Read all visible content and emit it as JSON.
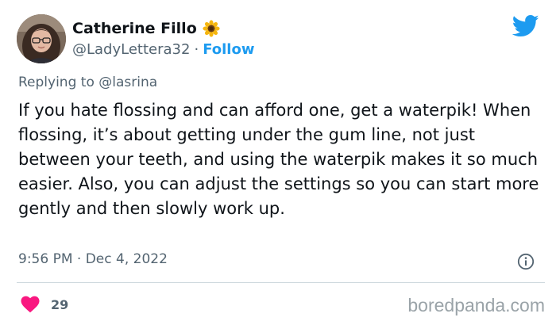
{
  "tweet": {
    "author": {
      "display_name": "Catherine Fillo",
      "name_emoji_icon": "sunflower-icon",
      "handle": "@LadyLettera32",
      "separator": "·",
      "follow_label": "Follow"
    },
    "brand_icon": "twitter-bird-icon",
    "reply_prefix": "Replying to",
    "reply_handle": "@lasrina",
    "text": "If you hate flossing and can afford one, get a waterpik! When flossing, it’s about getting under the gum line, not just between your teeth, and using the waterpik makes it so much easier. Also, you can adjust the settings so you can start more gently and then slowly work up.",
    "time": "9:56 PM",
    "date_separator": "·",
    "date": "Dec 4, 2022",
    "info_icon": "info-icon",
    "likes": {
      "icon": "heart-icon",
      "count": "29"
    }
  },
  "watermark": "boredpanda.com",
  "colors": {
    "link_blue": "#1d9bf0",
    "heart_red": "#f91880",
    "muted_text": "#536471",
    "body_text": "#0f1419",
    "divider": "#cfd9de",
    "watermark": "#9aa3a8"
  }
}
